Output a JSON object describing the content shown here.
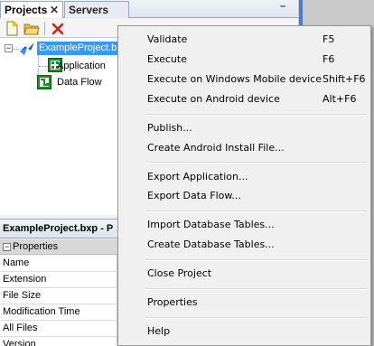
{
  "tabs": [
    {
      "label": "Projects",
      "close": "✕"
    },
    {
      "label": "Servers"
    }
  ],
  "panel": {
    "minimize": "–"
  },
  "tree": {
    "root_label": "ExampleProject.b",
    "children": [
      "Application",
      "Data Flow"
    ]
  },
  "properties": {
    "title": "ExampleProject.bxp - P",
    "section": "Properties",
    "rows": [
      "Name",
      "Extension",
      "File Size",
      "Modification Time",
      "All Files",
      "Version"
    ]
  },
  "context_menu": {
    "groups": [
      [
        {
          "label": "Validate",
          "shortcut": "F5"
        },
        {
          "label": "Execute",
          "shortcut": "F6"
        },
        {
          "label": "Execute on Windows Mobile device",
          "shortcut": "Shift+F6"
        },
        {
          "label": "Execute on Android device",
          "shortcut": "Alt+F6"
        }
      ],
      [
        {
          "label": "Publish..."
        },
        {
          "label": "Create Android Install File..."
        }
      ],
      [
        {
          "label": "Export Application..."
        },
        {
          "label": "Export Data Flow..."
        }
      ],
      [
        {
          "label": "Import Database Tables..."
        },
        {
          "label": "Create Database Tables..."
        }
      ],
      [
        {
          "label": "Close Project"
        }
      ],
      [
        {
          "label": "Properties"
        }
      ],
      [
        {
          "label": "Help"
        }
      ]
    ]
  },
  "colors": {
    "selection": "#3399ff",
    "menu_background": "#f0f0f0",
    "icon_green": "#1e8a2e",
    "accent_blue": "#4a7bd2"
  }
}
